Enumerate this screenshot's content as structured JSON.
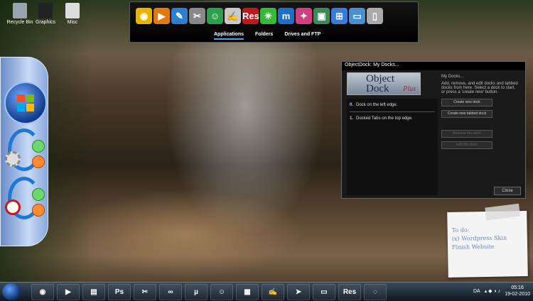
{
  "desktop_icons": [
    {
      "label": "Recycle Bin",
      "icon": "recycle-bin-icon"
    },
    {
      "label": "Graphics",
      "icon": "folder-icon"
    },
    {
      "label": "Misc",
      "icon": "folder-icon"
    }
  ],
  "top_dock": {
    "icons": [
      {
        "name": "chrome-icon",
        "glyph": "◉",
        "color": "#e8b400"
      },
      {
        "name": "media-player-icon",
        "glyph": "▶",
        "color": "#e07a10"
      },
      {
        "name": "inkscape-icon",
        "glyph": "✎",
        "color": "#2a7fd0"
      },
      {
        "name": "tools-icon",
        "glyph": "✂",
        "color": "#888888"
      },
      {
        "name": "messenger-icon",
        "glyph": "☺",
        "color": "#2aa14a"
      },
      {
        "name": "notepad-icon",
        "glyph": "✍",
        "color": "#c9c9c9"
      },
      {
        "name": "resource-hacker-icon",
        "glyph": "Res",
        "color": "#c01818"
      },
      {
        "name": "green-app-icon",
        "glyph": "✳",
        "color": "#38b838"
      },
      {
        "name": "maxthon-icon",
        "glyph": "m",
        "color": "#1e6fc8"
      },
      {
        "name": "multicolor-app-icon",
        "glyph": "✦",
        "color": "#d04080"
      },
      {
        "name": "window-app-icon",
        "glyph": "▣",
        "color": "#3a8a5a"
      },
      {
        "name": "windows-flag-icon",
        "glyph": "⊞",
        "color": "#3a7ad8"
      },
      {
        "name": "monitor-icon",
        "glyph": "▭",
        "color": "#4a90d0"
      },
      {
        "name": "phone-icon",
        "glyph": "▯",
        "color": "#aaaaaa"
      }
    ],
    "tabs": [
      "Applications",
      "Folders",
      "Drives and FTP"
    ]
  },
  "dialog": {
    "title": "ObjectDock: My Docks...",
    "logo_line1": "Object",
    "logo_line2": "Dock",
    "logo_plus": "Plus",
    "docks": [
      {
        "index": "0.",
        "label": "Dock on the left edge."
      },
      {
        "index": "1.",
        "label": "Docked Tabs on the top edge."
      }
    ],
    "side_heading": "My Docks...",
    "side_text": "Add, remove, and edit docks and tabbed docks from here. Select a dock to start, or press a 'create new' button.",
    "buttons": [
      "Create new dock",
      "Create new tabbed dock"
    ],
    "disabled_buttons": [
      "Remove this dock",
      "Edit this dock"
    ],
    "close_label": "Close"
  },
  "note": {
    "lines": [
      "To do:",
      "(x) Wordpress Skin",
      "Finish Website"
    ]
  },
  "taskbar": {
    "items": [
      {
        "name": "chrome-icon",
        "glyph": "◉"
      },
      {
        "name": "media-player-icon",
        "glyph": "▶"
      },
      {
        "name": "folder-icon",
        "glyph": "▤"
      },
      {
        "name": "photoshop-icon",
        "glyph": "Ps"
      },
      {
        "name": "tools-icon",
        "glyph": "✂"
      },
      {
        "name": "infinity-icon",
        "glyph": "∞"
      },
      {
        "name": "torrent-icon",
        "glyph": "µ"
      },
      {
        "name": "messenger-icon",
        "glyph": "☺"
      },
      {
        "name": "film-icon",
        "glyph": "▦"
      },
      {
        "name": "notepad-icon",
        "glyph": "✍"
      },
      {
        "name": "cursor-icon",
        "glyph": "➤"
      },
      {
        "name": "monitor-icon",
        "glyph": "▭"
      },
      {
        "name": "resource-hacker-icon",
        "glyph": "Res"
      },
      {
        "name": "objectdock-icon",
        "glyph": "◌"
      }
    ],
    "language": "DA",
    "time": "05:16",
    "date": "19-02-2010"
  }
}
